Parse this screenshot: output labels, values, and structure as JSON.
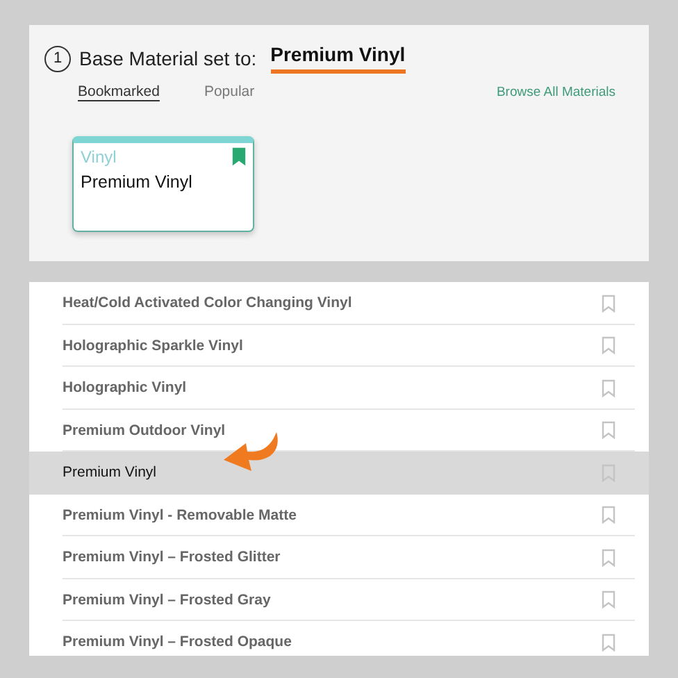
{
  "header": {
    "step": "1",
    "label": "Base Material set to:",
    "value": "Premium Vinyl",
    "value_underlined": true
  },
  "tabs": [
    {
      "label": "Bookmarked",
      "selected": true
    },
    {
      "label": "Popular",
      "selected": false
    }
  ],
  "browse_link": "Browse All Materials",
  "cards": [
    {
      "category": "Vinyl",
      "name": "Premium Vinyl",
      "bookmarked": true
    }
  ],
  "materials": [
    {
      "name": "Heat/Cold Activated Color Changing Vinyl",
      "selected": false,
      "bookmarked": false
    },
    {
      "name": "Holographic Sparkle Vinyl",
      "selected": false,
      "bookmarked": false
    },
    {
      "name": "Holographic Vinyl",
      "selected": false,
      "bookmarked": false
    },
    {
      "name": "Premium Outdoor Vinyl",
      "selected": false,
      "bookmarked": false
    },
    {
      "name": "Premium Vinyl",
      "selected": true,
      "bookmarked": false
    },
    {
      "name": "Premium Vinyl - Removable Matte",
      "selected": false,
      "bookmarked": false
    },
    {
      "name": "Premium Vinyl – Frosted Glitter",
      "selected": false,
      "bookmarked": false
    },
    {
      "name": "Premium Vinyl – Frosted Gray",
      "selected": false,
      "bookmarked": false
    },
    {
      "name": "Premium Vinyl – Frosted Opaque",
      "selected": false,
      "bookmarked": false
    }
  ]
}
